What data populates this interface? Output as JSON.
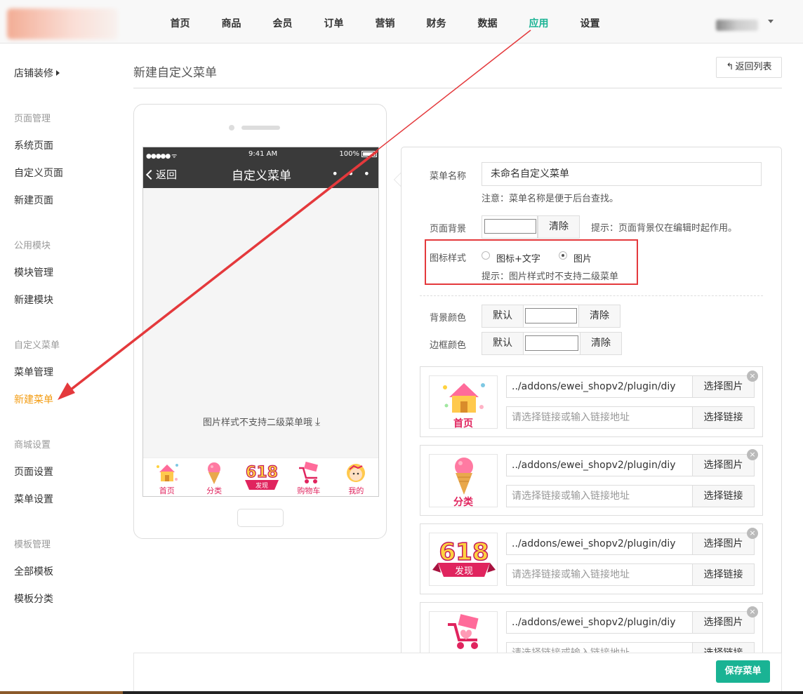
{
  "topnav": {
    "items": [
      "首页",
      "商品",
      "会员",
      "订单",
      "营销",
      "财务",
      "数据",
      "应用",
      "设置"
    ],
    "active_index": 7,
    "accent_color": "#1ab394"
  },
  "sidebar": {
    "shop_decor": "店铺装修",
    "groups": [
      {
        "title": "页面管理",
        "items": [
          "系统页面",
          "自定义页面",
          "新建页面"
        ]
      },
      {
        "title": "公用模块",
        "items": [
          "模块管理",
          "新建模块"
        ]
      },
      {
        "title": "自定义菜单",
        "items": [
          "菜单管理",
          "新建菜单"
        ]
      },
      {
        "title": "商城设置",
        "items": [
          "页面设置",
          "菜单设置"
        ]
      },
      {
        "title": "模板管理",
        "items": [
          "全部模板",
          "模板分类"
        ]
      }
    ],
    "active_item": "新建菜单",
    "active_color": "#f39c12"
  },
  "header": {
    "title": "新建自定义菜单",
    "back_button": "返回列表"
  },
  "phone": {
    "status_time": "9:41 AM",
    "status_battery": "100%",
    "back_label": "返回",
    "title": "自定义菜单",
    "more": "• • •",
    "tip": "图片样式不支持二级菜单哦",
    "tabs": [
      "首页",
      "分类",
      "",
      "购物车",
      "我的"
    ],
    "badge_618": "618",
    "badge_618_sub": "发现"
  },
  "editor": {
    "menu_name_label": "菜单名称",
    "menu_name_value": "未命名自定义菜单",
    "menu_name_note": "注意：菜单名称是便于后台查找。",
    "page_bg_label": "页面背景",
    "clear_label": "清除",
    "page_bg_hint": "提示：页面背景仅在编辑时起作用。",
    "icon_style_label": "图标样式",
    "icon_style_options": [
      "图标+文字",
      "图片"
    ],
    "icon_style_selected": "图片",
    "icon_style_hint": "提示：图片样式时不支持二级菜单",
    "bg_color_label": "背景颜色",
    "border_color_label": "边框颜色",
    "default_label": "默认",
    "highlight_color": "#e4393c"
  },
  "menu_items": [
    {
      "thumb": "首页",
      "image_path": "../addons/ewei_shopv2/plugin/diy",
      "image_button": "选择图片",
      "link_placeholder": "请选择链接或输入链接地址",
      "link_button": "选择链接",
      "close": "×"
    },
    {
      "thumb": "分类",
      "image_path": "../addons/ewei_shopv2/plugin/diy",
      "image_button": "选择图片",
      "link_placeholder": "请选择链接或输入链接地址",
      "link_button": "选择链接",
      "close": "×"
    },
    {
      "thumb": "发现",
      "image_path": "../addons/ewei_shopv2/plugin/diy",
      "image_button": "选择图片",
      "link_placeholder": "请选择链接或输入链接地址",
      "link_button": "选择链接",
      "close": "×"
    },
    {
      "thumb": "",
      "image_path": "../addons/ewei_shopv2/plugin/diy",
      "image_button": "选择图片",
      "link_placeholder": "请选择链接或输入链接地址",
      "link_button": "选择链接",
      "close": "×"
    }
  ],
  "footer": {
    "save_button": "保存菜单"
  }
}
